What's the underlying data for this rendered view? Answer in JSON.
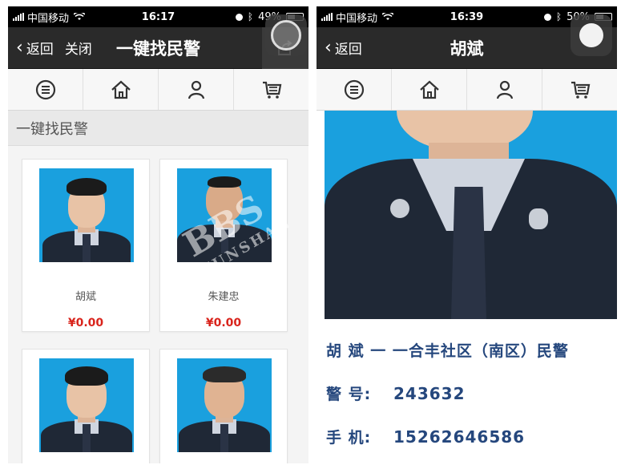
{
  "left": {
    "status": {
      "carrier": "中国移动",
      "time": "16:17",
      "battery": "49%",
      "battery_level": 0.49
    },
    "nav": {
      "back": "返回",
      "close": "关闭",
      "title": "一键找民警"
    },
    "toolbar": [
      {
        "icon": "menu-icon"
      },
      {
        "icon": "home-icon"
      },
      {
        "icon": "person-icon"
      },
      {
        "icon": "cart-icon"
      }
    ],
    "section_title": "一键找民警",
    "officers": [
      {
        "name": "胡斌",
        "price": "¥0.00"
      },
      {
        "name": "朱建忠",
        "price": "¥0.00"
      },
      {
        "name": "",
        "price": ""
      },
      {
        "name": "",
        "price": ""
      }
    ]
  },
  "right": {
    "status": {
      "carrier": "中国移动",
      "time": "16:39",
      "battery": "50%",
      "battery_level": 0.5
    },
    "nav": {
      "back": "返回",
      "title": "胡斌"
    },
    "detail": {
      "heading": "胡 斌 一 一合丰社区（南区）民警",
      "badge_label": "警 号:",
      "badge_value": "243632",
      "phone_label": "手 机:",
      "phone_value": "15262646586"
    }
  },
  "watermark": {
    "main": "BBS",
    "sub": "KUNSHAN"
  },
  "colors": {
    "navbar": "#2a2a2a",
    "price": "#d9241c",
    "detail_text": "#25477d",
    "photo_bg": "#1aa0de"
  }
}
